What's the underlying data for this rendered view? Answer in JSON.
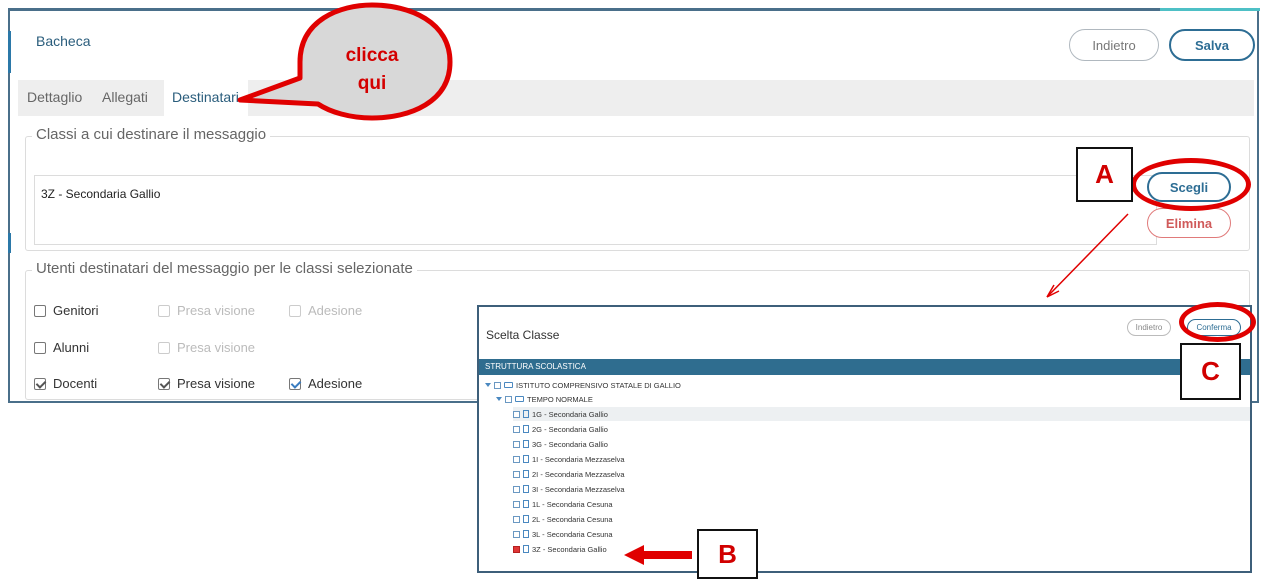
{
  "window": {
    "title": "Bacheca",
    "indietro_label": "Indietro",
    "salva_label": "Salva"
  },
  "tabs": [
    {
      "label": "Dettaglio"
    },
    {
      "label": "Allegati"
    },
    {
      "label": "Destinatari"
    }
  ],
  "classi": {
    "legend": "Classi a cui destinare il messaggio",
    "selected": "3Z - Secondaria Gallio",
    "scegli_label": "Scegli",
    "elimina_label": "Elimina"
  },
  "utenti": {
    "legend": "Utenti destinatari del messaggio per le classi selezionate",
    "rows": [
      {
        "label": "Genitori",
        "presa": "Presa visione",
        "adesione": "Adesione"
      },
      {
        "label": "Alunni",
        "presa": "Presa visione"
      },
      {
        "label": "Docenti",
        "presa": "Presa visione",
        "adesione": "Adesione"
      }
    ]
  },
  "popup": {
    "title": "Scelta Classe",
    "indietro_label": "Indietro",
    "conferma_label": "Conferma",
    "header": "STRUTTURA SCOLASTICA",
    "root": "ISTITUTO COMPRENSIVO STATALE DI GALLIO",
    "group": "TEMPO NORMALE",
    "classes": [
      "1G - Secondaria Gallio",
      "2G - Secondaria Gallio",
      "3G - Secondaria Gallio",
      "1I - Secondaria Mezzaselva",
      "2I - Secondaria Mezzaselva",
      "3I - Secondaria Mezzaselva",
      "1L - Secondaria Cesuna",
      "2L - Secondaria Cesuna",
      "3L - Secondaria Cesuna",
      "3Z - Secondaria Gallio"
    ]
  },
  "annotations": {
    "bubble_line1": "clicca",
    "bubble_line2": "qui",
    "label_a": "A",
    "label_b": "B",
    "label_c": "C",
    "color": "#e00000"
  }
}
